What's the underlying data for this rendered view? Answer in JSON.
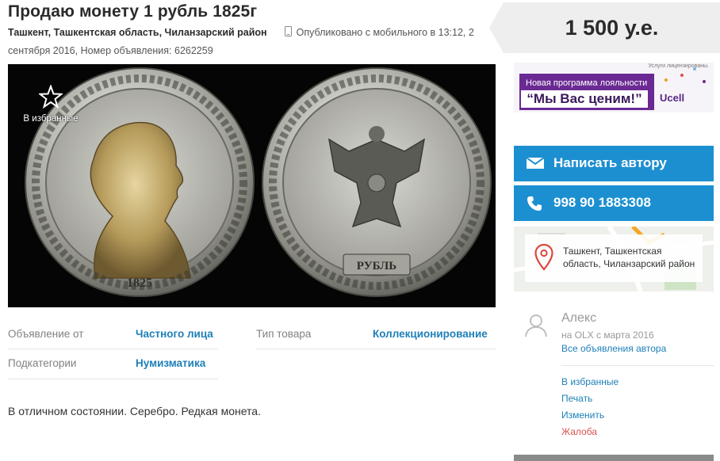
{
  "ad_title": "Продаю монету 1 рубль 1825г",
  "location": "Ташкент, Ташкентская область, Чиланзарский район",
  "published_part1": "Опубликовано с мобильного в 13:12, 2",
  "published_part2": "сентября 2016, Номер объявления: 6262259",
  "favorite_label": "В избранные",
  "params": [
    {
      "label": "Объявление от",
      "value": "Частного лица"
    },
    {
      "label": "Тип товара",
      "value": "Коллекционирование"
    },
    {
      "label": "Подкатегории",
      "value": "Нумизматика"
    }
  ],
  "description": "В отличном состоянии. Серебро. Редкая монета.",
  "price": "1 500 у.е.",
  "banner": {
    "small": "Услуги лицензированы.",
    "line1": "Новая программа лояльности",
    "line2": "“Мы Вас ценим!”",
    "brand": "Ucell"
  },
  "message_button": "Написать автору",
  "phone": "998 90 1883308",
  "map_address": "Ташкент, Ташкентская область, Чиланзарский район",
  "user": {
    "name": "Алекс",
    "since": "на OLX с марта 2016",
    "all_ads": "Все объявления автора"
  },
  "actions": [
    {
      "label": "В избранные",
      "color": "#1e7fb8"
    },
    {
      "label": "Печать",
      "color": "#1e7fb8"
    },
    {
      "label": "Изменить",
      "color": "#1e7fb8"
    },
    {
      "label": "Жалоба",
      "color": "#d9534f"
    }
  ],
  "colors": {
    "accent": "#1c8fd1",
    "link": "#1e7fb8",
    "price_bg": "#eeeeee"
  },
  "icons": [
    "star-icon",
    "mobile-icon",
    "envelope-icon",
    "phone-icon",
    "map-pin-icon",
    "user-avatar-icon"
  ]
}
